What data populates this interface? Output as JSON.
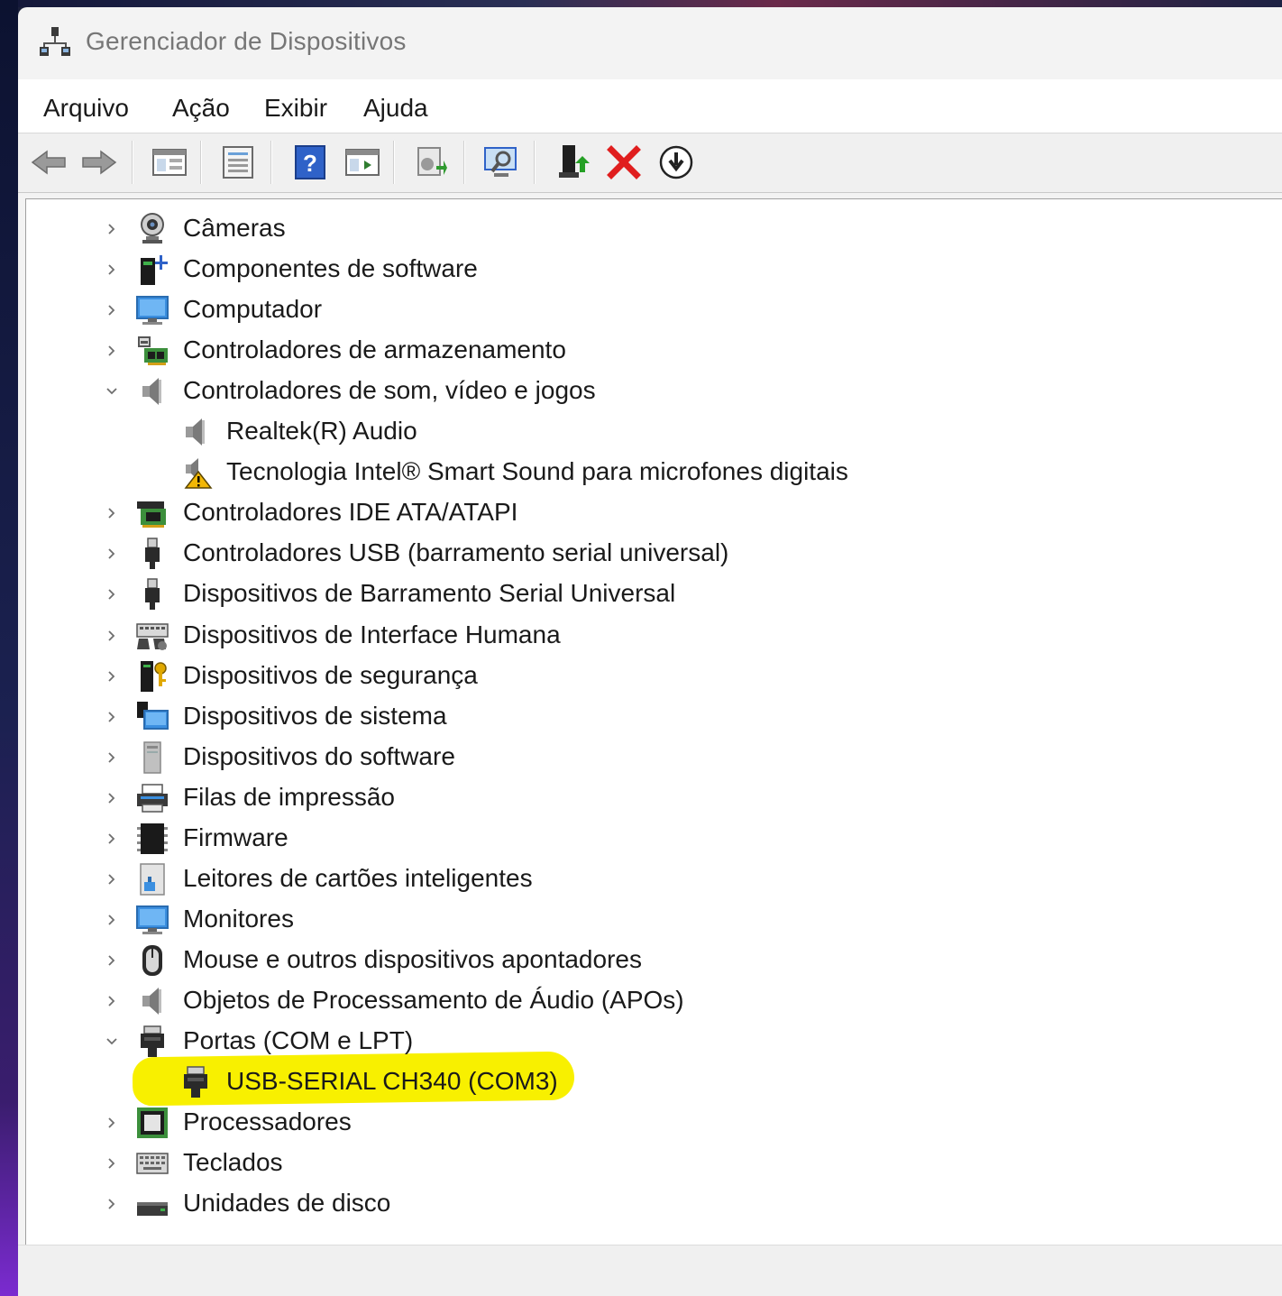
{
  "window": {
    "title": "Gerenciador de Dispositivos"
  },
  "menu": [
    "Arquivo",
    "Ação",
    "Exibir",
    "Ajuda"
  ],
  "toolbar": {
    "buttons": [
      "back-arrow-icon",
      "forward-arrow-icon",
      "properties-grid-icon",
      "properties-sheet-icon",
      "help-icon",
      "view-panel-icon",
      "update-driver-icon",
      "scan-hardware-icon",
      "enable-device-icon",
      "uninstall-x-icon",
      "download-icon"
    ]
  },
  "tree": [
    {
      "label": "Câmeras",
      "icon": "camera-icon",
      "expanded": false,
      "depth": 0
    },
    {
      "label": "Componentes de software",
      "icon": "software-component-icon",
      "expanded": false,
      "depth": 0
    },
    {
      "label": "Computador",
      "icon": "monitor-icon",
      "expanded": false,
      "depth": 0
    },
    {
      "label": "Controladores de armazenamento",
      "icon": "storage-controller-icon",
      "expanded": false,
      "depth": 0
    },
    {
      "label": "Controladores de som, vídeo e jogos",
      "icon": "speaker-icon",
      "expanded": true,
      "depth": 0
    },
    {
      "label": "Realtek(R) Audio",
      "icon": "speaker-icon",
      "depth": 1
    },
    {
      "label": "Tecnologia Intel® Smart Sound para microfones digitais",
      "icon": "speaker-warning-icon",
      "depth": 1
    },
    {
      "label": "Controladores IDE ATA/ATAPI",
      "icon": "ide-controller-icon",
      "expanded": false,
      "depth": 0
    },
    {
      "label": "Controladores USB (barramento serial universal)",
      "icon": "usb-plug-icon",
      "expanded": false,
      "depth": 0
    },
    {
      "label": "Dispositivos de Barramento Serial Universal",
      "icon": "usb-plug-icon",
      "expanded": false,
      "depth": 0
    },
    {
      "label": "Dispositivos de Interface Humana",
      "icon": "hid-icon",
      "expanded": false,
      "depth": 0
    },
    {
      "label": "Dispositivos de segurança",
      "icon": "security-key-icon",
      "expanded": false,
      "depth": 0
    },
    {
      "label": "Dispositivos de sistema",
      "icon": "system-folder-icon",
      "expanded": false,
      "depth": 0
    },
    {
      "label": "Dispositivos do software",
      "icon": "software-device-icon",
      "expanded": false,
      "depth": 0
    },
    {
      "label": "Filas de impressão",
      "icon": "printer-icon",
      "expanded": false,
      "depth": 0
    },
    {
      "label": "Firmware",
      "icon": "firmware-chip-icon",
      "expanded": false,
      "depth": 0
    },
    {
      "label": "Leitores de cartões inteligentes",
      "icon": "smart-card-reader-icon",
      "expanded": false,
      "depth": 0
    },
    {
      "label": "Monitores",
      "icon": "monitor-icon",
      "expanded": false,
      "depth": 0
    },
    {
      "label": "Mouse e outros dispositivos apontadores",
      "icon": "mouse-icon",
      "expanded": false,
      "depth": 0
    },
    {
      "label": "Objetos de Processamento de Áudio (APOs)",
      "icon": "speaker-icon",
      "expanded": false,
      "depth": 0
    },
    {
      "label": "Portas (COM e LPT)",
      "icon": "port-connector-icon",
      "expanded": true,
      "depth": 0
    },
    {
      "label": "USB-SERIAL CH340 (COM3)",
      "icon": "port-connector-icon",
      "depth": 1,
      "highlighted": true
    },
    {
      "label": "Processadores",
      "icon": "processor-icon",
      "expanded": false,
      "depth": 0
    },
    {
      "label": "Teclados",
      "icon": "keyboard-icon",
      "expanded": false,
      "depth": 0
    },
    {
      "label": "Unidades de disco",
      "icon": "disk-drive-icon",
      "expanded": false,
      "depth": 0
    }
  ],
  "colors": {
    "highlight": "#f8f000",
    "window_bg": "#f3f3f3",
    "content_bg": "#ffffff"
  }
}
